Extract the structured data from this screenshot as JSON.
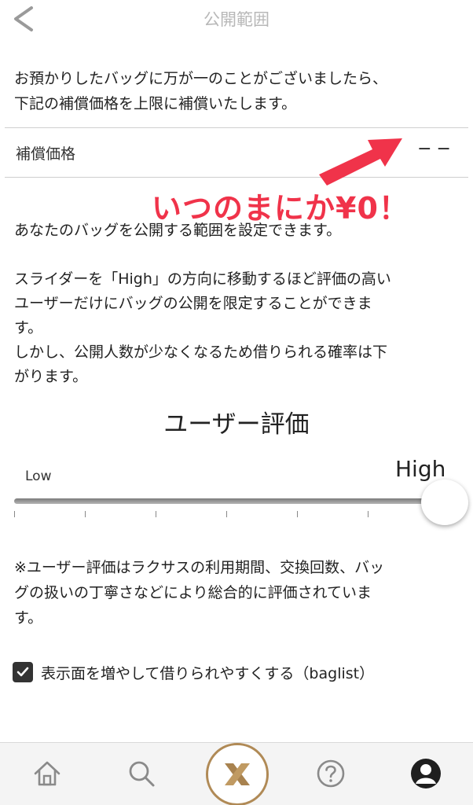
{
  "header": {
    "title": "公開範囲",
    "back_icon": "chevron-left-icon"
  },
  "notice": {
    "line1": "お預かりしたバッグに万が一のことがございましたら、",
    "line2": "下記の補償価格を上限に補償いたします。"
  },
  "compensation": {
    "label": "補償価格",
    "value": "−−"
  },
  "annotation": {
    "text": "いつのまにか¥0！",
    "color": "#f0334a"
  },
  "description": {
    "p1": "あなたのバッグを公開する範囲を設定できます。",
    "p2_l1": "スライダーを「High」の方向に移動するほど評価の高い",
    "p2_l2": "ユーザーだけにバッグの公開を限定することができま",
    "p2_l3": "す。",
    "p3_l1": "しかし、公開人数が少なくなるため借りられる確率は下",
    "p3_l2": "がります。"
  },
  "rating": {
    "title": "ユーザー評価",
    "low_label": "Low",
    "high_label": "High",
    "slider_level": 1.0,
    "tick_count": 7
  },
  "note": {
    "l1": "※ユーザー評価はラクサスの利用期間、交換回数、バッ",
    "l2": "グの扱いの丁寧さなどにより総合的に評価されていま",
    "l3": "す。"
  },
  "option": {
    "label": "表示面を増やして借りられやすくする（baglist）",
    "checked": true
  },
  "tabbar": {
    "items": [
      "home-icon",
      "search-icon",
      "laxus-logo",
      "help-icon",
      "profile-icon"
    ],
    "accent": "#b08a56"
  }
}
